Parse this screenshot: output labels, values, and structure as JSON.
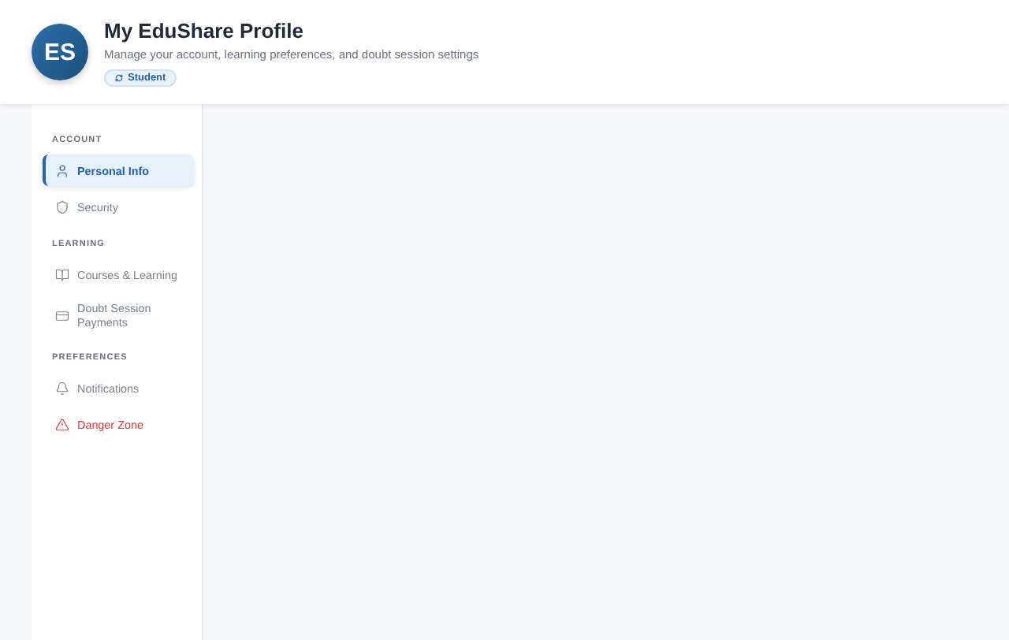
{
  "header": {
    "avatar": "ES",
    "title": "My EduShare Profile",
    "subtitle": "Manage your account, learning preferences, and doubt session settings",
    "badge": "Student"
  },
  "sidebar": {
    "sections": [
      {
        "label": "ACCOUNT",
        "items": [
          {
            "label": "Personal Info",
            "kind": "normal",
            "selected": true
          },
          {
            "label": "Security",
            "kind": "normal",
            "selected": false
          }
        ]
      },
      {
        "label": "LEARNING",
        "items": [
          {
            "label": "Courses & Learning",
            "kind": "normal",
            "selected": false
          },
          {
            "label": "Doubt Session Payments",
            "kind": "normal",
            "selected": false
          }
        ]
      },
      {
        "label": "PREFERENCES",
        "items": [
          {
            "label": "Notifications",
            "kind": "normal",
            "selected": false
          },
          {
            "label": "Danger Zone",
            "kind": "danger",
            "selected": false
          }
        ]
      }
    ]
  }
}
